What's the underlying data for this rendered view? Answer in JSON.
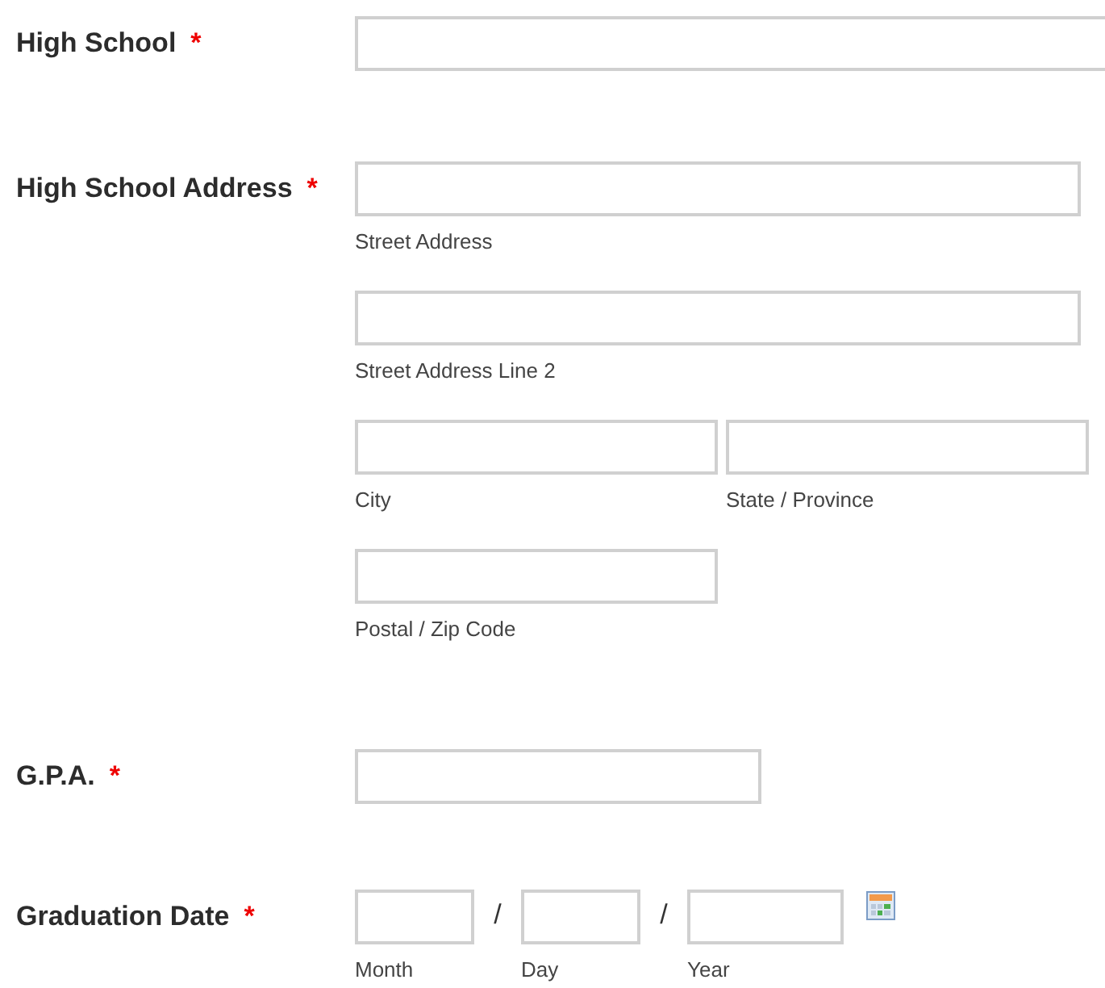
{
  "required_mark": "*",
  "fields": [
    {
      "kind": "text",
      "label": "High School",
      "required": true
    },
    {
      "kind": "address",
      "label": "High School Address",
      "required": true,
      "rows": [
        [
          {
            "sublabel": "Street Address"
          }
        ],
        [
          {
            "sublabel": "Street Address Line 2"
          }
        ],
        [
          {
            "sublabel": "City"
          },
          {
            "sublabel": "State / Province"
          }
        ],
        [
          {
            "sublabel": "Postal / Zip Code"
          }
        ]
      ]
    },
    {
      "kind": "text",
      "label": "G.P.A.",
      "required": true
    },
    {
      "kind": "date",
      "label": "Graduation Date",
      "required": true,
      "parts": [
        {
          "sublabel": "Month",
          "separator": "/"
        },
        {
          "sublabel": "Day",
          "separator": "/"
        },
        {
          "sublabel": "Year"
        }
      ]
    }
  ]
}
